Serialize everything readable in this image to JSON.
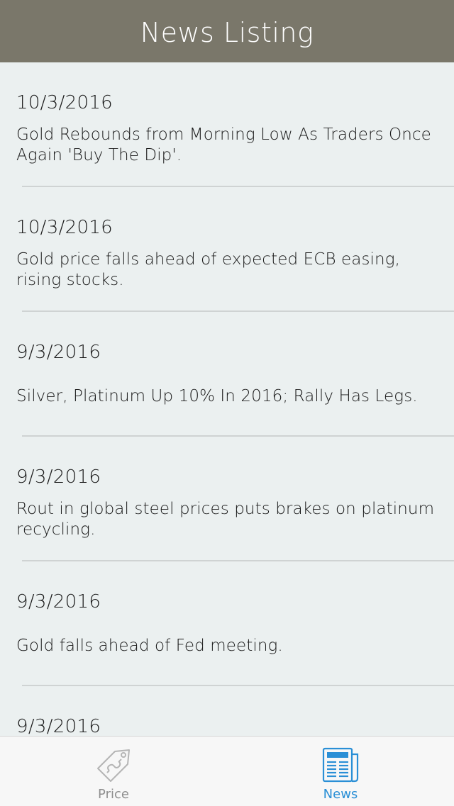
{
  "header": {
    "title": "News Listing"
  },
  "news": [
    {
      "date": "10/3/2016",
      "headline": "Gold Rebounds from Morning Low As Traders Once Again 'Buy The Dip'."
    },
    {
      "date": "10/3/2016",
      "headline": "Gold price falls ahead of expected ECB easing, rising stocks."
    },
    {
      "date": "9/3/2016",
      "headline": "Silver, Platinum Up 10% In 2016; Rally Has Legs."
    },
    {
      "date": "9/3/2016",
      "headline": "Rout in global steel prices puts brakes on platinum recycling."
    },
    {
      "date": "9/3/2016",
      "headline": "Gold falls ahead of Fed meeting."
    },
    {
      "date": "9/3/2016",
      "headline": ""
    }
  ],
  "tabbar": {
    "tabs": [
      {
        "label": "Price",
        "icon": "price-tag-icon",
        "active": false
      },
      {
        "label": "News",
        "icon": "newspaper-icon",
        "active": true
      }
    ]
  },
  "colors": {
    "header_bg": "#7a776a",
    "list_bg": "#ebf0f0",
    "active_tab": "#2a8fd6",
    "inactive_tab": "#8e8e8e"
  }
}
